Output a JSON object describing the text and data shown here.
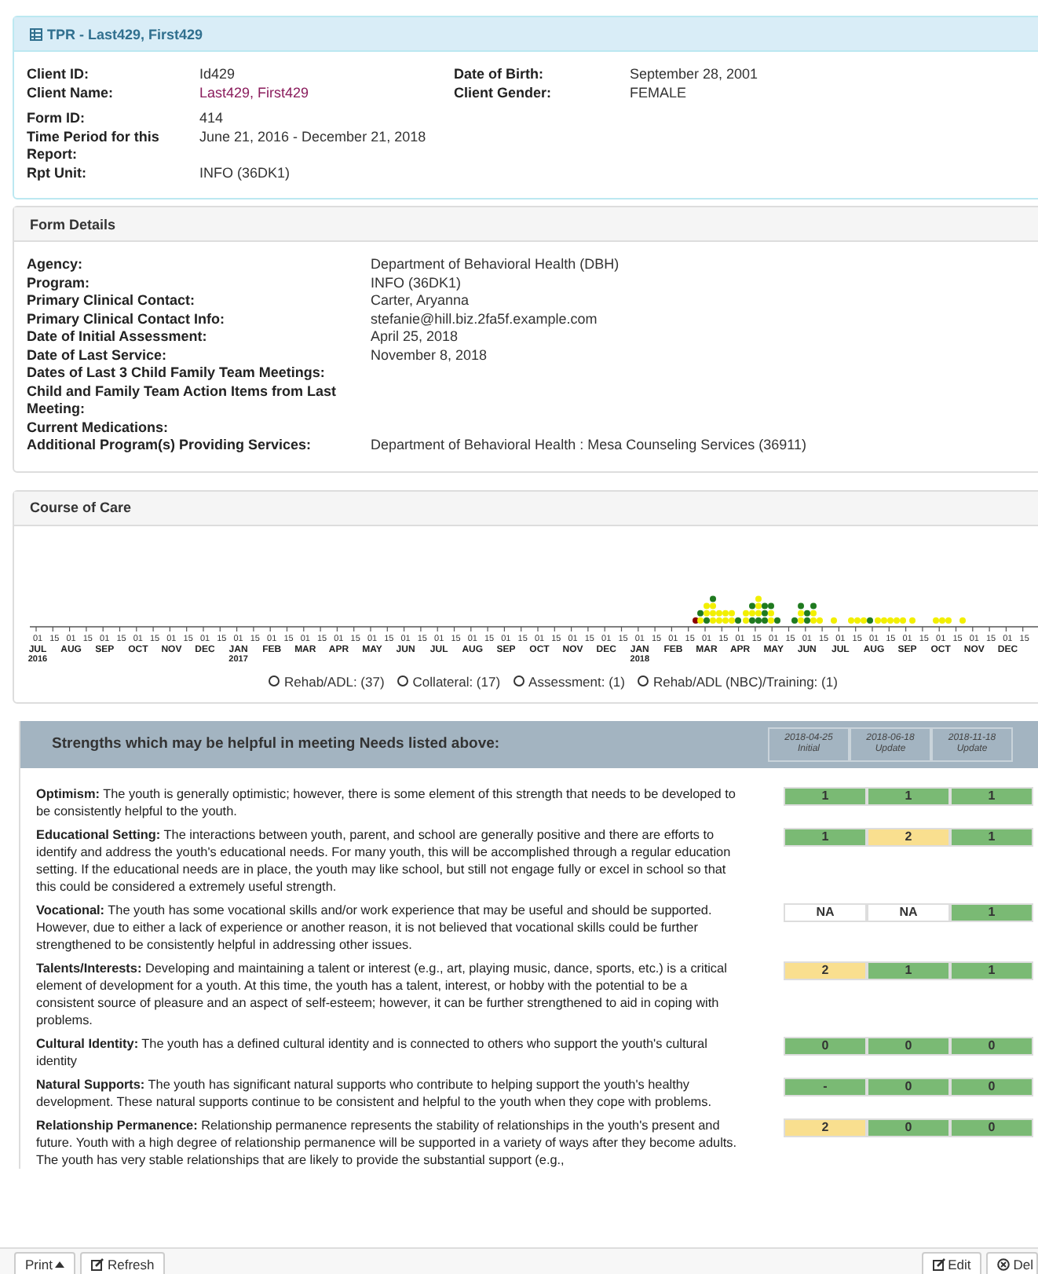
{
  "client_panel": {
    "title": "TPR - Last429, First429",
    "left_groups": [
      [
        {
          "label": "Client ID:",
          "value": "Id429",
          "kind": "text"
        },
        {
          "label": "Client Name:",
          "value": "Last429, First429",
          "kind": "link"
        }
      ],
      [
        {
          "label": "Form ID:",
          "value": "414",
          "kind": "text"
        },
        {
          "label": "Time Period for this Report:",
          "value": "June 21, 2016 - December 21, 2018",
          "kind": "text"
        },
        {
          "label": "Rpt Unit:",
          "value": "INFO (36DK1)",
          "kind": "text"
        }
      ]
    ],
    "right_groups": [
      [
        {
          "label": "Date of Birth:",
          "value": "September 28, 2001",
          "kind": "text"
        },
        {
          "label": "Client Gender:",
          "value": "FEMALE",
          "kind": "text"
        }
      ]
    ]
  },
  "form_details": {
    "title": "Form Details",
    "fields": [
      {
        "label": "Agency:",
        "value": "Department of Behavioral Health (DBH)"
      },
      {
        "label": "Program:",
        "value": "INFO (36DK1)"
      },
      {
        "label": "Primary Clinical Contact:",
        "value": "Carter, Aryanna"
      },
      {
        "label": "Primary Clinical Contact Info:",
        "value": "stefanie@hill.biz.2fa5f.example.com"
      },
      {
        "label": "Date of Initial Assessment:",
        "value": "April 25, 2018"
      },
      {
        "label": "Date of Last Service:",
        "value": "November 8, 2018"
      },
      {
        "label": "Dates of Last 3 Child Family Team Meetings:"
      },
      {
        "label": "Child and Family Team Action Items from Last Meeting:"
      },
      {
        "label": "Current Medications:"
      },
      {
        "label": "Additional Program(s) Providing Services:",
        "value": "Department of Behavioral Health : Mesa Counseling Services (36911)"
      }
    ]
  },
  "course_of_care": {
    "title": "Course of Care",
    "months": [
      {
        "label": "JUL",
        "year": "2016",
        "ticks": [
          "01",
          "15"
        ]
      },
      {
        "label": "AUG",
        "ticks": [
          "01",
          "15"
        ]
      },
      {
        "label": "SEP",
        "ticks": [
          "01",
          "15"
        ]
      },
      {
        "label": "OCT",
        "ticks": [
          "01",
          "15"
        ]
      },
      {
        "label": "NOV",
        "ticks": [
          "01",
          "15"
        ]
      },
      {
        "label": "DEC",
        "ticks": [
          "01",
          "15"
        ]
      },
      {
        "label": "JAN",
        "year": "2017",
        "ticks": [
          "01",
          "15"
        ]
      },
      {
        "label": "FEB",
        "ticks": [
          "01",
          "15"
        ]
      },
      {
        "label": "MAR",
        "ticks": [
          "01",
          "15"
        ]
      },
      {
        "label": "APR",
        "ticks": [
          "01",
          "15"
        ]
      },
      {
        "label": "MAY",
        "ticks": [
          "01",
          "15"
        ]
      },
      {
        "label": "JUN",
        "ticks": [
          "01",
          "15"
        ]
      },
      {
        "label": "JUL",
        "ticks": [
          "01",
          "15"
        ]
      },
      {
        "label": "AUG",
        "ticks": [
          "01",
          "15"
        ]
      },
      {
        "label": "SEP",
        "ticks": [
          "01",
          "15"
        ]
      },
      {
        "label": "OCT",
        "ticks": [
          "01",
          "15"
        ]
      },
      {
        "label": "NOV",
        "ticks": [
          "01",
          "15"
        ]
      },
      {
        "label": "DEC",
        "ticks": [
          "01",
          "15"
        ]
      },
      {
        "label": "JAN",
        "year": "2018",
        "ticks": [
          "01",
          "15"
        ]
      },
      {
        "label": "FEB",
        "ticks": [
          "01",
          "15"
        ]
      },
      {
        "label": "MAR",
        "ticks": [
          "01",
          "15"
        ]
      },
      {
        "label": "APR",
        "ticks": [
          "01",
          "15"
        ]
      },
      {
        "label": "MAY",
        "ticks": [
          "01",
          "15"
        ]
      },
      {
        "label": "JUN",
        "ticks": [
          "01",
          "15"
        ]
      },
      {
        "label": "JUL",
        "ticks": [
          "01",
          "15"
        ]
      },
      {
        "label": "AUG",
        "ticks": [
          "01",
          "15"
        ]
      },
      {
        "label": "SEP",
        "ticks": [
          "01",
          "15"
        ]
      },
      {
        "label": "OCT",
        "ticks": [
          "01",
          "15"
        ]
      },
      {
        "label": "NOV",
        "ticks": [
          "01",
          "15"
        ]
      },
      {
        "label": "DEC",
        "ticks": [
          "01",
          "15"
        ]
      }
    ],
    "legend": [
      "Rehab/ADL: (37)",
      "Collateral: (17)",
      "Assessment: (1)",
      "Rehab/ADL (NBC)/Training: (1)"
    ]
  },
  "strengths": {
    "title": "Strengths which may be helpful in meeting Needs listed above:",
    "columns": [
      {
        "date": "2018-04-25",
        "type": "Initial"
      },
      {
        "date": "2018-06-18",
        "type": "Update"
      },
      {
        "date": "2018-11-18",
        "type": "Update"
      }
    ],
    "rows": [
      {
        "text": "**Optimism:** The youth is generally optimistic; however, there is some element of this strength that needs to be developed to be consistently helpful to the youth.",
        "scores": [
          {
            "value": "1",
            "color": "#7aba74"
          },
          {
            "value": "1",
            "color": "#7aba74"
          },
          {
            "value": "1",
            "color": "#7aba74"
          }
        ]
      },
      {
        "text": "**Educational Setting:** The interactions between youth, parent, and school are generally positive and there are efforts to identify and address the youth's educational needs. For many youth, this will be accomplished through a regular education setting. If the educational needs are in place, the youth may like school, but still not engage fully or excel in school so that this could be considered a extremely useful strength.",
        "scores": [
          {
            "value": "1",
            "color": "#7aba74"
          },
          {
            "value": "2",
            "color": "#f9df8f"
          },
          {
            "value": "1",
            "color": "#7aba74"
          }
        ]
      },
      {
        "text": "**Vocational:** The youth has some vocational skills and/or work experience that may be useful and should be supported. However, due to either a lack of experience or another reason, it is not believed that vocational skills could be further strengthened to be consistently helpful in addressing other issues.",
        "scores": [
          {
            "value": "NA",
            "color": "#ffffff"
          },
          {
            "value": "NA",
            "color": "#ffffff"
          },
          {
            "value": "1",
            "color": "#7aba74"
          }
        ]
      },
      {
        "text": "**Talents/Interests:** Developing and maintaining a talent or interest (e.g., art, playing music, dance, sports, etc.) is a critical element of development for a youth. At this time, the youth has a talent, interest, or hobby with the potential to be a consistent source of pleasure and an aspect of self-esteem; however, it can be further strengthened to aid in coping with problems.",
        "scores": [
          {
            "value": "2",
            "color": "#f9df8f"
          },
          {
            "value": "1",
            "color": "#7aba74"
          },
          {
            "value": "1",
            "color": "#7aba74"
          }
        ]
      },
      {
        "text": "**Cultural Identity:** The youth has a defined cultural identity and is connected to others who support the youth's cultural identity",
        "scores": [
          {
            "value": "0",
            "color": "#7aba74"
          },
          {
            "value": "0",
            "color": "#7aba74"
          },
          {
            "value": "0",
            "color": "#7aba74"
          }
        ]
      },
      {
        "text": "**Natural Supports:** The youth has significant natural supports who contribute to helping support the youth's healthy development. These natural supports continue to be consistent and helpful to the youth when they cope with problems.",
        "scores": [
          {
            "value": "-",
            "color": "#7aba74"
          },
          {
            "value": "0",
            "color": "#7aba74"
          },
          {
            "value": "0",
            "color": "#7aba74"
          }
        ]
      },
      {
        "text": "**Relationship Permanence:** Relationship permanence represents the stability of relationships in the youth's present and future. Youth with a high degree of relationship permanence will be supported in a variety of ways after they become adults. The youth has very stable relationships that are likely to provide the substantial support (e.g.,",
        "scores": [
          {
            "value": "2",
            "color": "#f9df8f"
          },
          {
            "value": "0",
            "color": "#7aba74"
          },
          {
            "value": "0",
            "color": "#7aba74"
          }
        ]
      }
    ]
  },
  "footer": {
    "left_buttons": [
      {
        "label": "Print",
        "kind": "dropdown"
      },
      {
        "label": "Refresh",
        "kind": "refresh"
      }
    ],
    "right_buttons": [
      {
        "label": "Edit",
        "kind": "edit"
      },
      {
        "label": "Del",
        "kind": "delete"
      }
    ]
  }
}
